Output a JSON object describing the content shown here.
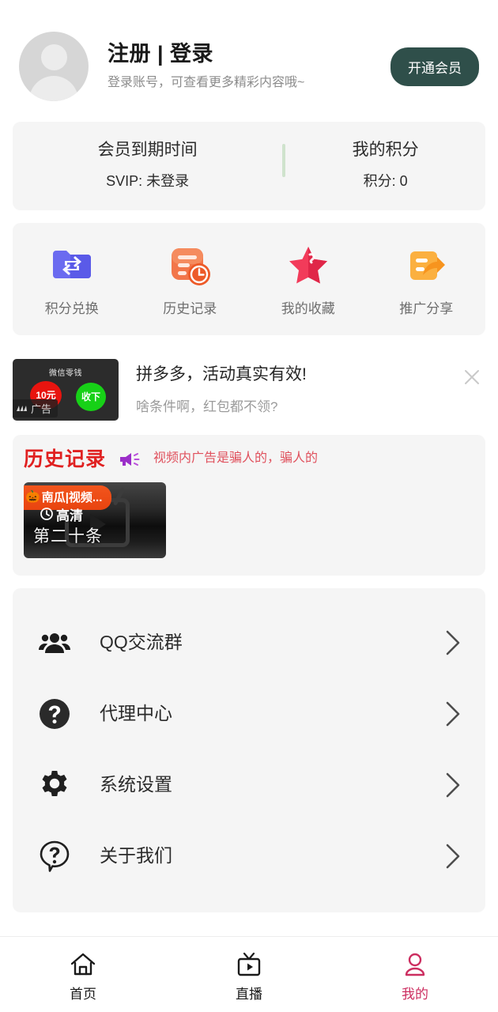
{
  "theme": {
    "page_bg": "#ffffff",
    "card_bg": "#f5f5f5",
    "vip_button_bg": "#2f4f4a",
    "history_title_color": "#e02020",
    "active_tab_color": "#cc2e60",
    "divider_green": "#cfe3cd"
  },
  "profile": {
    "avatar_icon": "user-avatar-placeholder-icon",
    "title": "注册 | 登录",
    "subtitle": "登录账号，可查看更多精彩内容哦~",
    "vip_button_label": "开通会员"
  },
  "stats": {
    "expiry": {
      "label": "会员到期时间",
      "value": "SVIP: 未登录"
    },
    "points": {
      "label": "我的积分",
      "value": "积分: 0"
    }
  },
  "quick_actions": [
    {
      "label": "积分兑换",
      "icon": "exchange-folder-icon"
    },
    {
      "label": "历史记录",
      "icon": "history-clock-icon"
    },
    {
      "label": "我的收藏",
      "icon": "star-favorite-icon"
    },
    {
      "label": "推广分享",
      "icon": "share-promote-icon"
    }
  ],
  "ad": {
    "thumb": {
      "title": "微信零钱",
      "red_coin_label": "10元",
      "green_coin_label": "收下",
      "badge_label": "广告"
    },
    "title": "拼多多，活动真实有效!",
    "subtitle": "啥条件啊，红包都不领?",
    "close_icon": "close-icon"
  },
  "history": {
    "title": "历史记录",
    "megaphone_icon": "megaphone-icon",
    "notice": "视频内广告是骗人的，骗人的",
    "items": [
      {
        "badge": "南瓜|视频...",
        "badge_emoji": "🎃",
        "quality": "高清",
        "name": "第二十条"
      }
    ]
  },
  "menu": [
    {
      "label": "QQ交流群",
      "icon": "people-group-icon",
      "arrow": "chevron-right-icon"
    },
    {
      "label": "代理中心",
      "icon": "question-mark-filled-icon",
      "arrow": "chevron-right-icon"
    },
    {
      "label": "系统设置",
      "icon": "gear-icon",
      "arrow": "chevron-right-icon"
    },
    {
      "label": "关于我们",
      "icon": "question-bubble-icon",
      "arrow": "chevron-right-icon"
    }
  ],
  "tabbar": [
    {
      "label": "首页",
      "icon": "home-icon",
      "active": false
    },
    {
      "label": "直播",
      "icon": "tv-live-icon",
      "active": false
    },
    {
      "label": "我的",
      "icon": "person-icon",
      "active": true
    }
  ]
}
